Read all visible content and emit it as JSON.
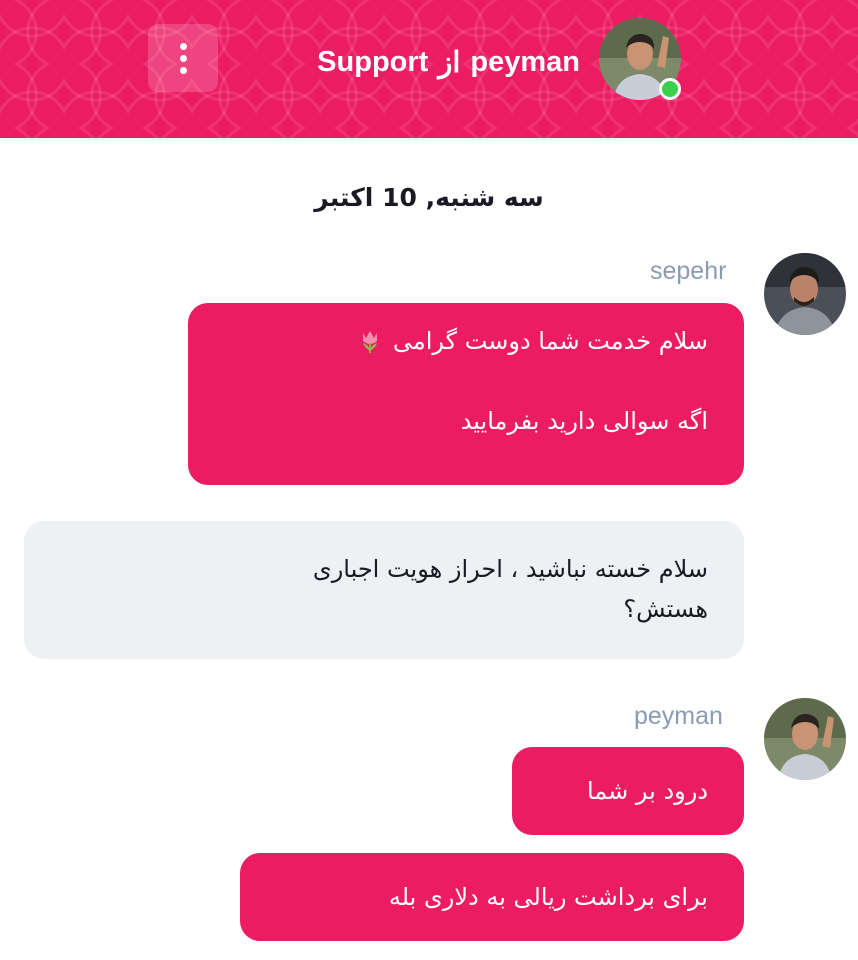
{
  "header": {
    "title_name": "peyman",
    "title_from": "از",
    "title_team": "Support",
    "status_color": "#3ecf4a",
    "accent_color": "#ec1c63"
  },
  "conversation": {
    "date_label": "سه شنبه, 10 اکتبر",
    "messages": [
      {
        "sender": "sepehr",
        "type": "agent",
        "lines": [
          "سلام خدمت شما دوست گرامی",
          "اگه سوالی دارید بفرمایید"
        ],
        "emoji": "tulip-icon"
      },
      {
        "type": "user",
        "lines": [
          "سلام خسته نباشید ، احراز هویت اجباری",
          "هستش؟"
        ]
      },
      {
        "sender": "peyman",
        "type": "agent",
        "lines": [
          "درود بر شما"
        ]
      },
      {
        "type": "agent",
        "lines": [
          "برای برداشت ریالی به دلاری بله"
        ]
      }
    ]
  }
}
